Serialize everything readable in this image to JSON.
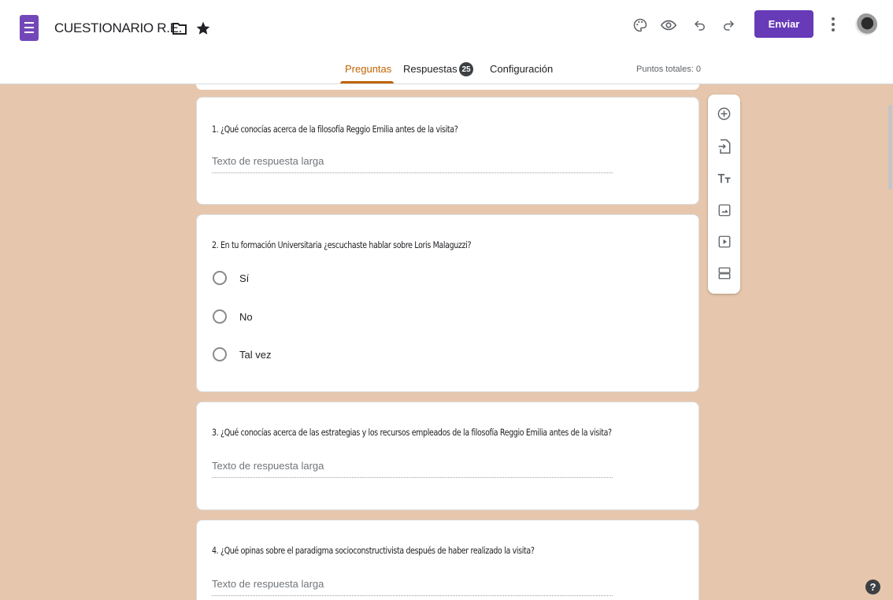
{
  "header": {
    "title": "CUESTIONARIO R.E.",
    "send_label": "Enviar"
  },
  "tabs": {
    "preguntas": "Preguntas",
    "respuestas": "Respuestas",
    "respuestas_count": "25",
    "configuracion": "Configuración",
    "active": "Preguntas"
  },
  "points_label": "Puntos totales: 0",
  "questions": [
    {
      "title": "1. ¿Qué conocías acerca de la filosofía Reggio Emilia antes de la visita?",
      "placeholder": "Texto de respuesta larga"
    },
    {
      "title": "2. En tu formación Universitaria ¿escuchaste hablar sobre Loris Malaguzzi?",
      "options": [
        "Sí",
        "No",
        "Tal vez"
      ]
    },
    {
      "title": "3. ¿Qué conocías acerca de las estrategias y los recursos empleados de la filosofía Reggio Emilia antes de la visita?",
      "placeholder": "Texto de respuesta larga"
    },
    {
      "title": "4. ¿Qué opinas sobre el paradigma socioconstructivista después de haber realizado la visita?",
      "placeholder": "Texto de respuesta larga"
    }
  ],
  "icons": {
    "toolbar": [
      "add-question-icon",
      "import-questions-icon",
      "add-title-icon",
      "add-image-icon",
      "add-video-icon",
      "add-section-icon"
    ],
    "header": [
      "forms-logo-icon",
      "folder-icon",
      "star-icon",
      "palette-icon",
      "eye-icon",
      "undo-icon",
      "redo-icon",
      "more-vert-icon"
    ]
  },
  "colors": {
    "accent": "#673ab7",
    "tab_active": "#c26401",
    "background": "#e6c7ad"
  },
  "help": "?"
}
